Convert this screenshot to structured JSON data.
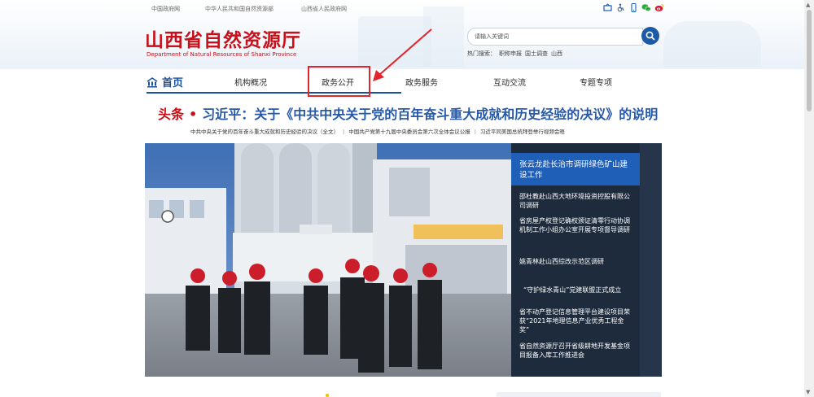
{
  "topbar": {
    "links": [
      "中国政府网",
      "中华人民共和国自然资源部",
      "山西省人民政府网"
    ],
    "icons": [
      "accessibility-icon",
      "wheelchair-icon",
      "mobile-icon",
      "wechat-icon",
      "weibo-icon"
    ]
  },
  "header": {
    "title_cn": "山西省自然资源厅",
    "title_en": "Department of Natural Resources of Shanxi Province"
  },
  "search": {
    "placeholder": "请输入关键词",
    "hot_label": "热门搜索：",
    "hot_terms": [
      "职称申报",
      "国土调查",
      "山西"
    ]
  },
  "nav": {
    "home": "首页",
    "items": [
      "机构概况",
      "政务公开",
      "政务服务",
      "互动交流",
      "专题专项"
    ]
  },
  "headline": {
    "tag": "头条",
    "text": "习近平：关于《中共中央关于党的百年奋斗重大成就和历史经验的决议》的说明",
    "sublinks": [
      "中共中央关于党的百年奋斗重大成就和历史经验的决议（全文）",
      "中国共产党第十九届中央委员会第六次全体会议公报",
      "习近平同美国总统拜登举行视频会晤"
    ]
  },
  "news": {
    "active": "张云龙赴长治市调研绿色矿山建设工作",
    "items": [
      "邵杜教赴山西大地环境投资控股有限公司调研",
      "省房屋产权登记确权颁证清零行动协调机制工作小组办公室开展专项督导调研",
      "姚青林赴山西综改示范区调研",
      "“守护绿水青山”党建联盟正式成立",
      "省不动产登记信息管理平台建设项目荣获“2021年地理信息产业优秀工程金奖”",
      "省自然资源厅召开省级耕地开发基金项目报备入库工作推进会"
    ]
  },
  "colors": {
    "brand_red": "#c8101a",
    "nav_blue": "#1a4f9a",
    "headline_blue": "#2859a8",
    "panel_dark": "#1d2b3c",
    "active_blue": "#1f5fb8",
    "highlight_red": "#e0262c"
  }
}
